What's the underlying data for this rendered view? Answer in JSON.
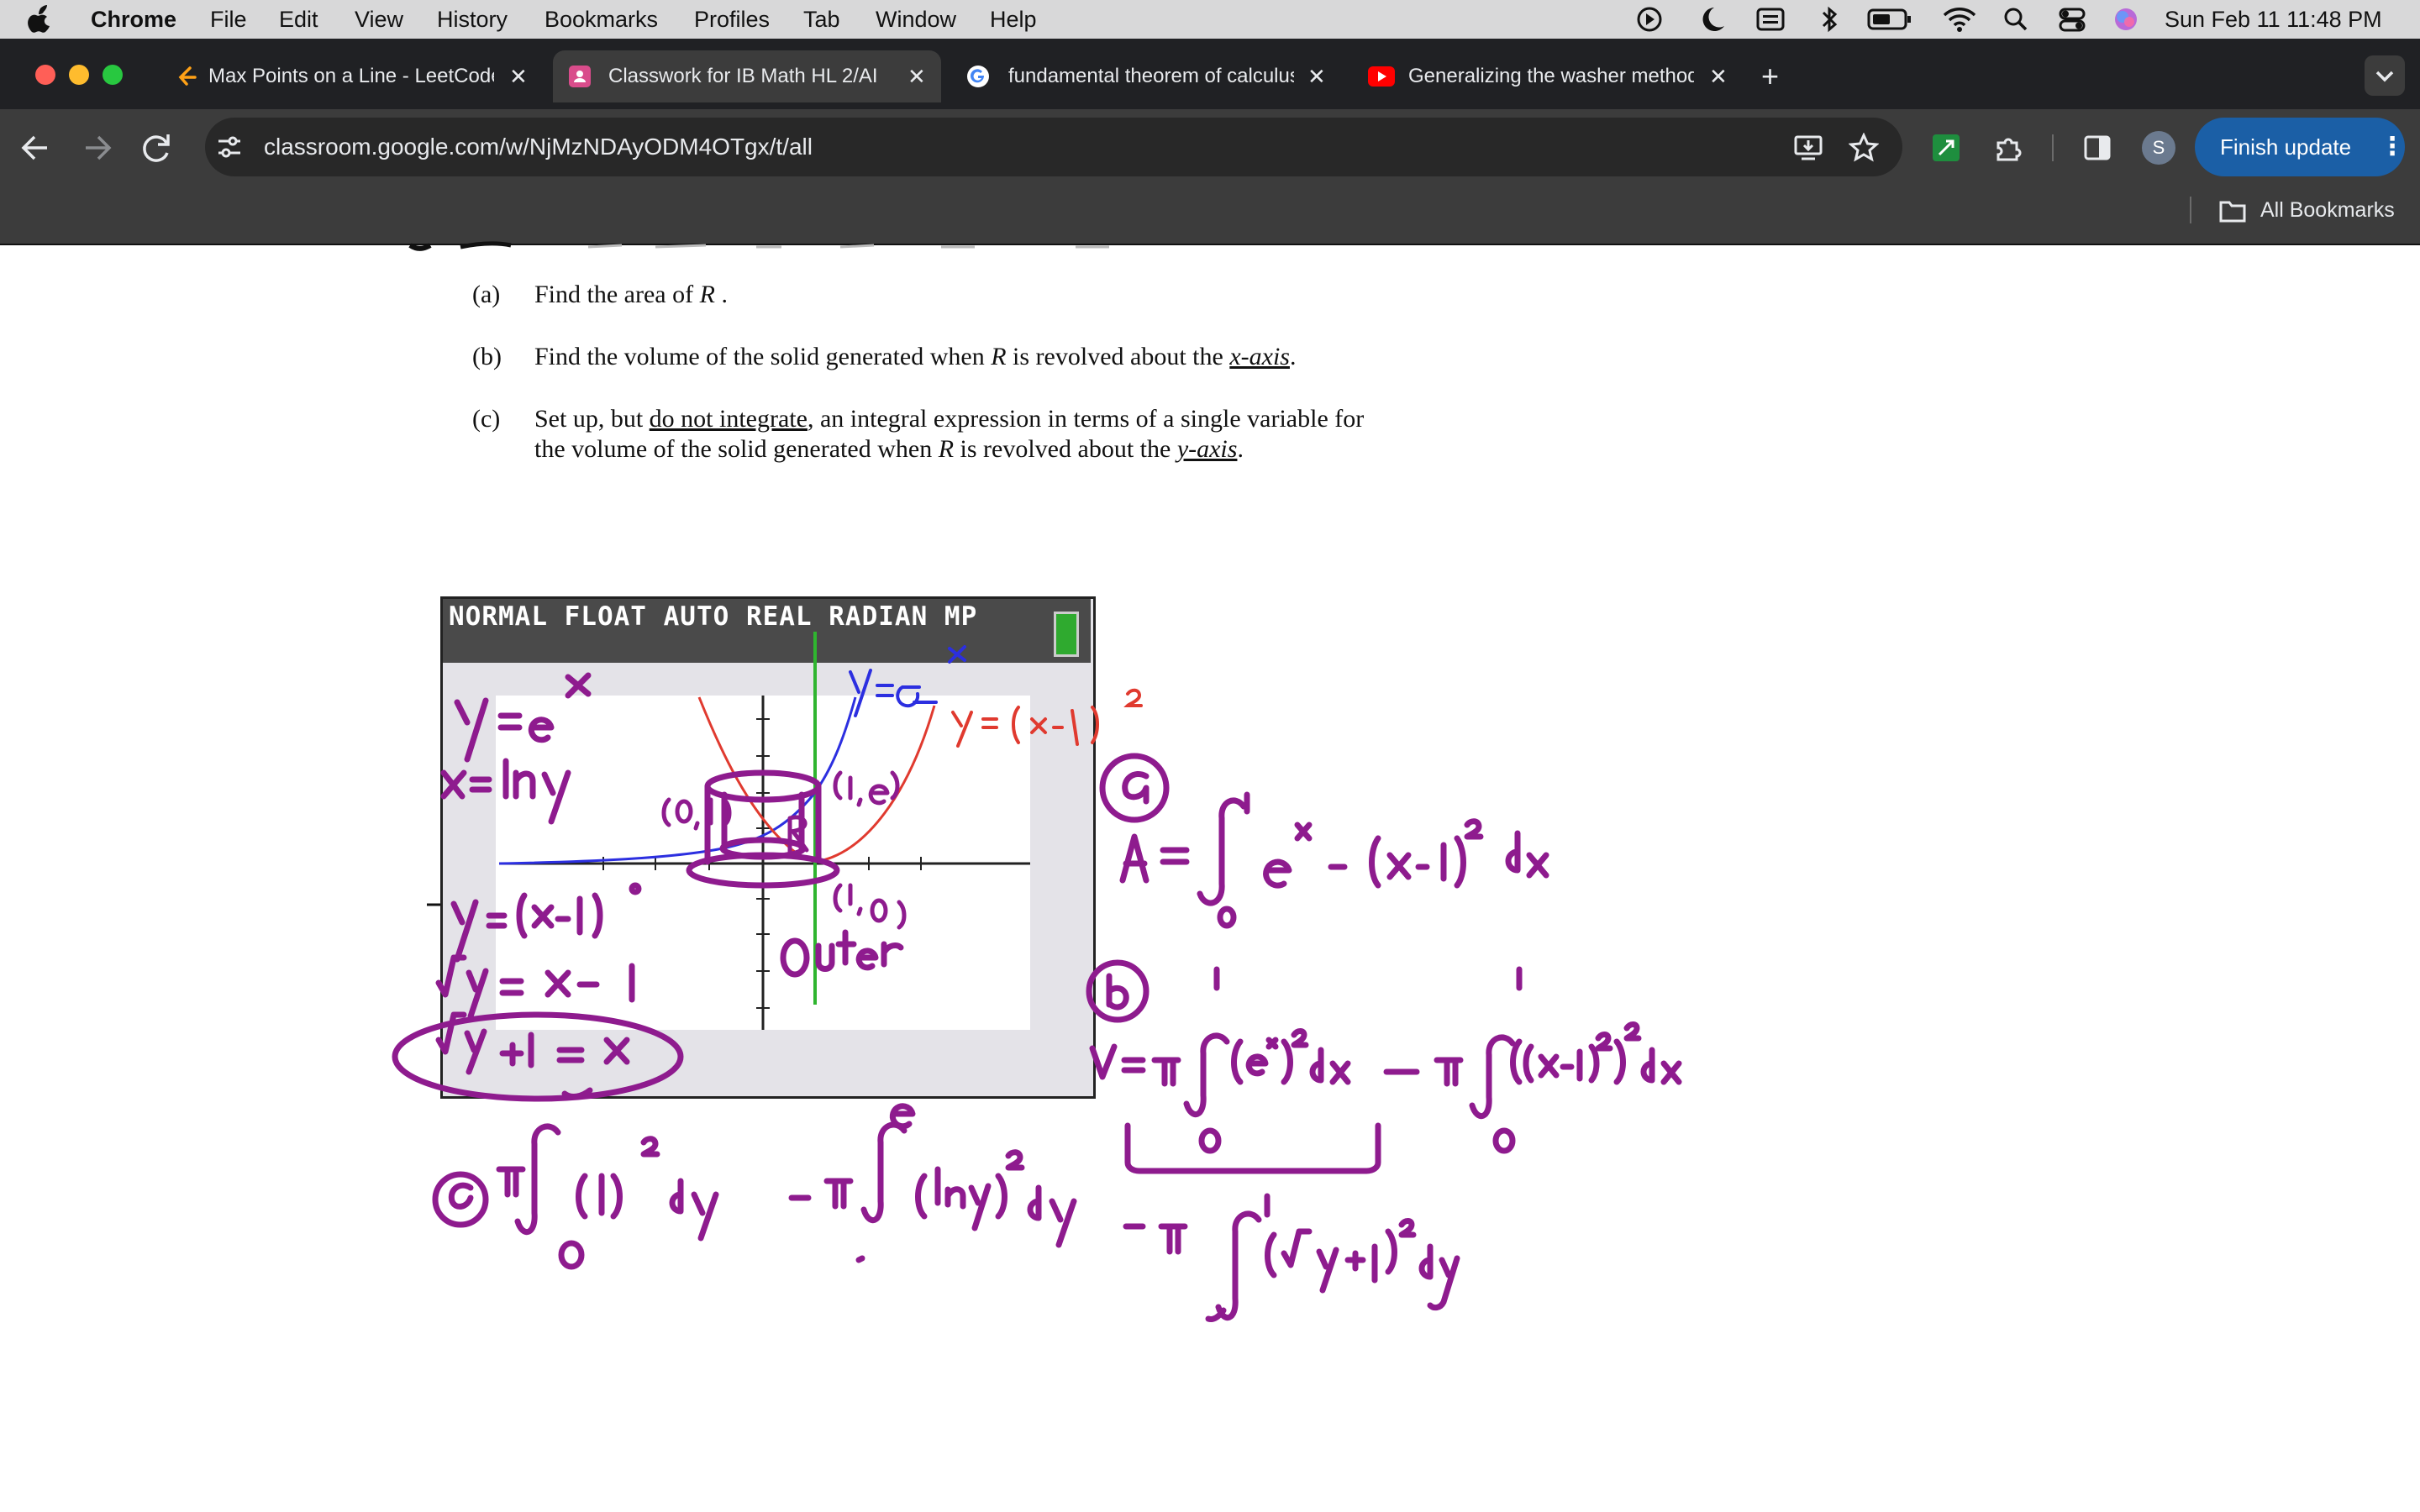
{
  "menubar": {
    "apple_icon": "apple-icon",
    "items": [
      "Chrome",
      "File",
      "Edit",
      "View",
      "History",
      "Bookmarks",
      "Profiles",
      "Tab",
      "Window",
      "Help"
    ],
    "datetime": "Sun Feb 11  11:48 PM",
    "status_icons": [
      "play-icon",
      "moon-icon",
      "keyboard-icon",
      "bluetooth-icon",
      "battery-icon",
      "wifi-icon",
      "search-icon",
      "control-center-icon",
      "siri-icon"
    ]
  },
  "tabs": [
    {
      "title": "Max Points on a Line - LeetCode",
      "favicon": "leetcode-icon",
      "active": false
    },
    {
      "title": "Classwork for IB Math HL 2/AI",
      "favicon": "classroom-icon",
      "active": true
    },
    {
      "title": "fundamental theorem of calculus",
      "favicon": "google-icon",
      "active": false
    },
    {
      "title": "Generalizing the washer method",
      "favicon": "youtube-icon",
      "active": false
    }
  ],
  "toolbar": {
    "url": "classroom.google.com/w/NjMzNDAyODM4OTgx/t/all",
    "finish_update": "Finish update",
    "profile_initial": "S",
    "all_bookmarks": "All Bookmarks"
  },
  "document": {
    "a_label": "(a)",
    "a_text_1": "Find the area of",
    "a_var": "R",
    "a_text_2": ".",
    "b_label": "(b)",
    "b_text_1": "Find the volume of the solid generated when",
    "b_var": "R",
    "b_text_2": "is revolved about the",
    "b_axis": "x-axis",
    "b_text_3": ".",
    "c_label": "(c)",
    "c_text_1": "Set up, but",
    "c_not": "do not integrate",
    "c_text_2": ", an integral expression in terms of a single variable for",
    "c_line2_1": "the volume of the solid generated when",
    "c_var": "R",
    "c_line2_2": "is revolved about the",
    "c_axis": "y-axis",
    "c_line2_3": "."
  },
  "calculator": {
    "status": "NORMAL FLOAT AUTO REAL RADIAN MP"
  },
  "colors": {
    "ink_purple": "#8e1b8e",
    "curve_blue": "#2c2fe0",
    "curve_red": "#e03a2f",
    "axis_green": "#2fb52f"
  }
}
